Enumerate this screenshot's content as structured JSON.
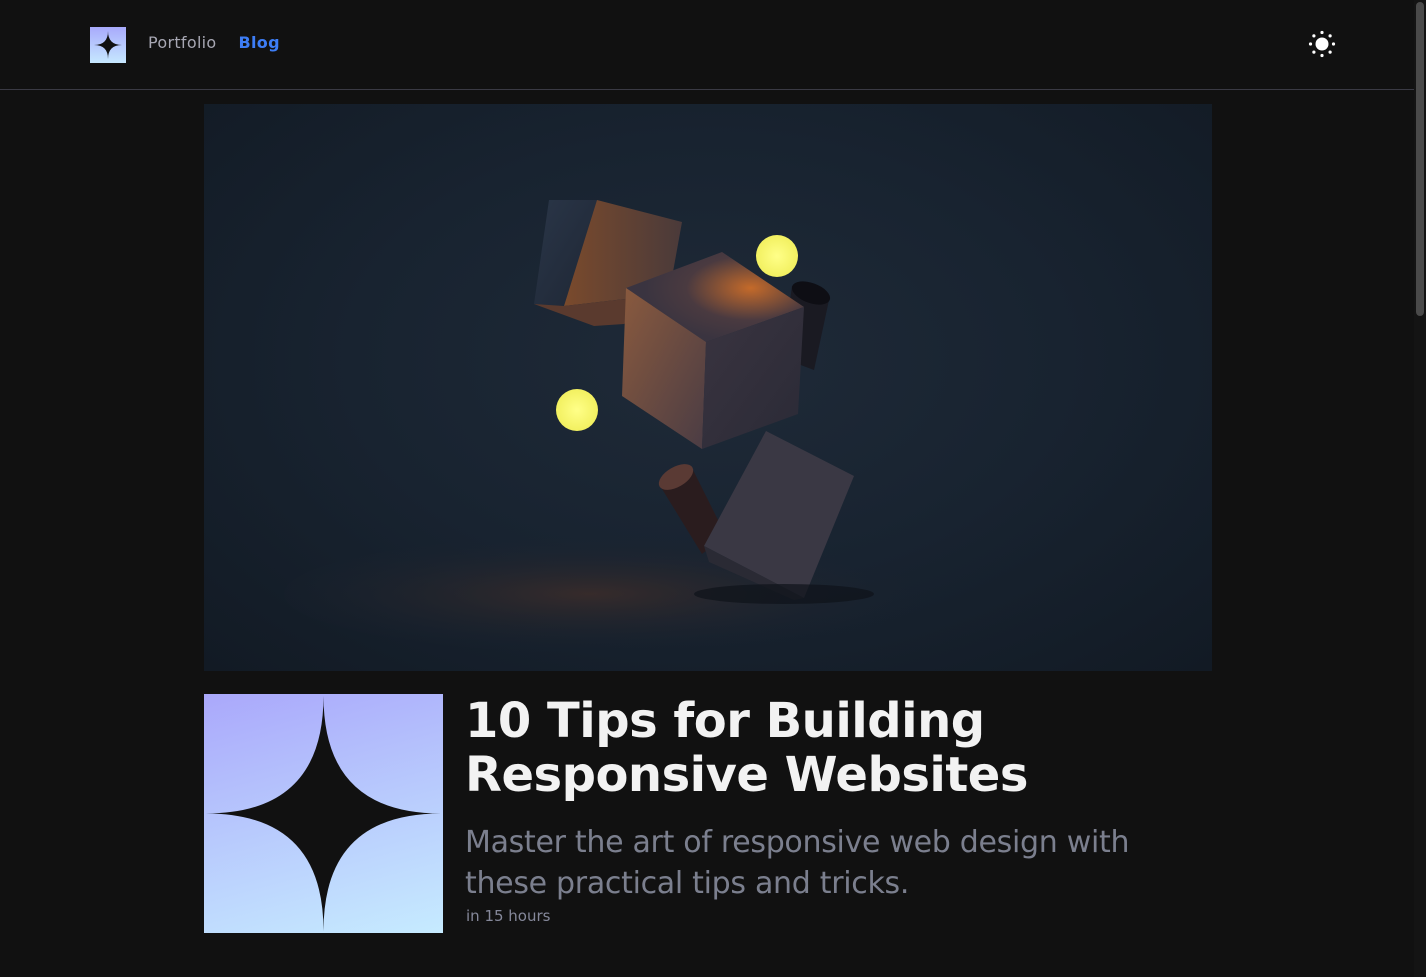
{
  "header": {
    "logo_icon": "sparkle-star-logo",
    "nav": [
      {
        "label": "Portfolio",
        "active": false
      },
      {
        "label": "Blog",
        "active": true
      }
    ],
    "theme_toggle_icon": "sun-icon"
  },
  "hero": {
    "image": "dark-3d-cubes-with-glowing-spheres"
  },
  "post": {
    "thumbnail_icon": "sparkle-star-icon",
    "title": "10 Tips for Building Responsive Websites",
    "excerpt": "Master the art of responsive web design with these practical tips and tricks.",
    "time": "in 15 hours"
  },
  "colors": {
    "background": "#111111",
    "accent": "#3d7df5",
    "thumb_gradient_start": "#aaa8fb",
    "thumb_gradient_end": "#c6ebff"
  }
}
